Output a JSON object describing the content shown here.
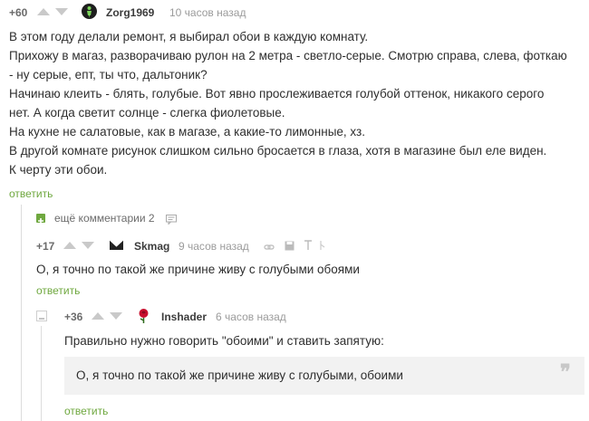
{
  "comments": [
    {
      "rating": "+60",
      "username": "Zorg1969",
      "time": "10 часов назад",
      "lines": [
        "В этом году делали ремонт, я выбирал обои в каждую комнату.",
        "Прихожу в магаз, разворачиваю рулон на 2 метра - светло-серые. Смотрю справа, слева, фоткаю",
        "- ну серые, епт, ты что, дальтоник?",
        "Начинаю клеить - блять, голубые. Вот явно прослеживается голубой оттенок, никакого серого",
        "нет. А когда светит солнце - слегка фиолетовые.",
        "На кухне не салатовые, как в магазе, а какие-то лимонные, хз.",
        "В другой комнате рисунок слишком сильно бросается в глаза, хотя в магазине был еле виден.",
        "К черту эти обои."
      ],
      "reply": "ответить"
    },
    {
      "more_comments": "ещё комментарии 2"
    },
    {
      "rating": "+17",
      "username": "Skmag",
      "time": "9 часов назад",
      "text": "О, я точно по такой же причине живу с голубыми обоями",
      "reply": "ответить"
    },
    {
      "rating": "+36",
      "username": "Inshader",
      "time": "6 часов назад",
      "text": "Правильно нужно говорить \"обоими\" и ставить запятую:",
      "quote": "О, я точно по такой же причине живу с голубыми, обоими",
      "reply": "ответить"
    }
  ],
  "colors": {
    "accent": "#6fa83f",
    "text": "#2e2e2e",
    "muted": "#9b9b9b"
  }
}
